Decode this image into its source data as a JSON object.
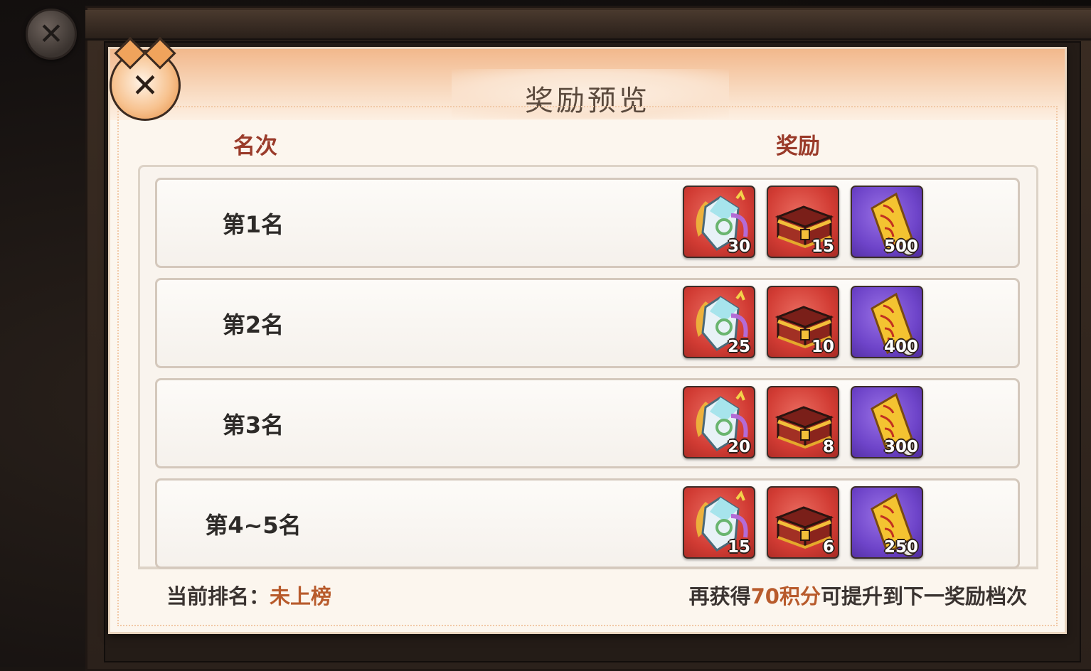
{
  "dialog": {
    "title": "奖励预览"
  },
  "columns": {
    "rank": "名次",
    "reward": "奖励"
  },
  "rows": [
    {
      "rank": "第1名",
      "rewards": [
        {
          "icon": "spirit-crystal-icon",
          "count": "30"
        },
        {
          "icon": "treasure-chest-icon",
          "count": "15"
        },
        {
          "icon": "talisman-scroll-icon",
          "count": "500"
        }
      ]
    },
    {
      "rank": "第2名",
      "rewards": [
        {
          "icon": "spirit-crystal-icon",
          "count": "25"
        },
        {
          "icon": "treasure-chest-icon",
          "count": "10"
        },
        {
          "icon": "talisman-scroll-icon",
          "count": "400"
        }
      ]
    },
    {
      "rank": "第3名",
      "rewards": [
        {
          "icon": "spirit-crystal-icon",
          "count": "20"
        },
        {
          "icon": "treasure-chest-icon",
          "count": "8"
        },
        {
          "icon": "talisman-scroll-icon",
          "count": "300"
        }
      ]
    },
    {
      "rank": "第4~5名",
      "rewards": [
        {
          "icon": "spirit-crystal-icon",
          "count": "15"
        },
        {
          "icon": "treasure-chest-icon",
          "count": "6"
        },
        {
          "icon": "talisman-scroll-icon",
          "count": "250"
        }
      ]
    }
  ],
  "footer": {
    "current_rank_label": "当前排名：",
    "current_rank_value": "未上榜",
    "progress_prefix": "再获得",
    "progress_points": "70积分",
    "progress_suffix": "可提升到下一奖励档次"
  },
  "colors": {
    "accent": "#b85b2c",
    "header": "#9a3b2a",
    "item_red": "#d13b33",
    "item_purple": "#6e44c9"
  }
}
